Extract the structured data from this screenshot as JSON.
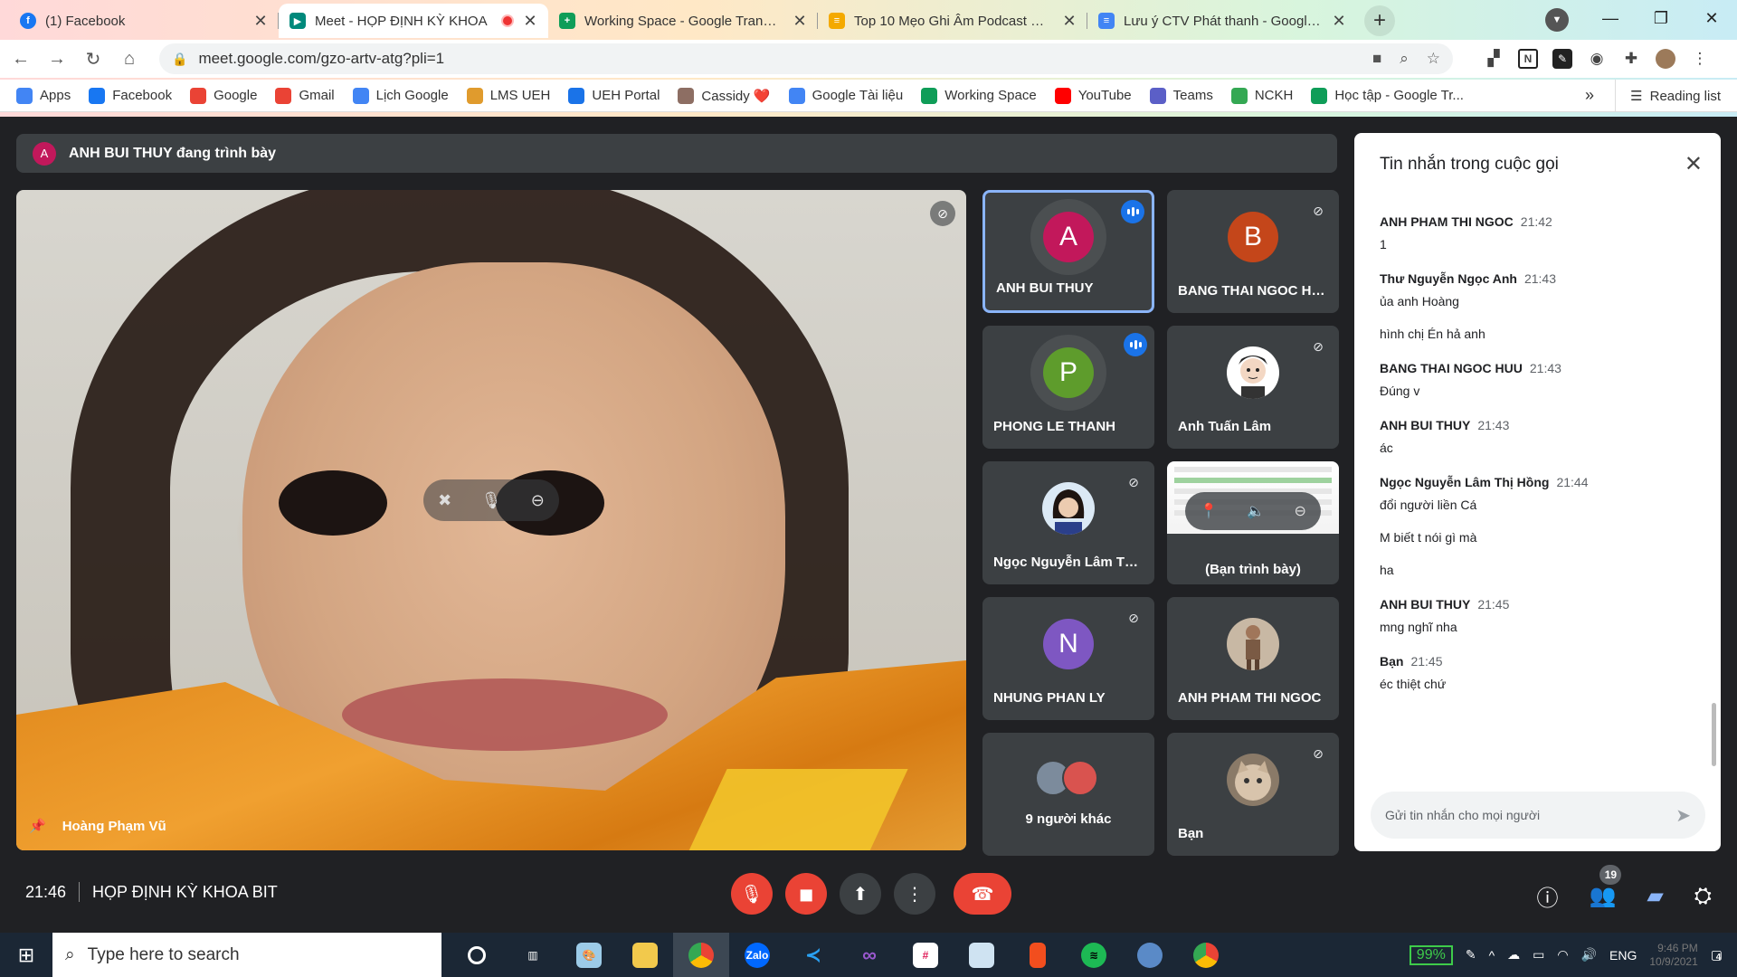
{
  "browser": {
    "tabs": [
      {
        "title": "(1) Facebook",
        "icon": "facebook-icon",
        "color": "#1877f2",
        "active": false
      },
      {
        "title": "Meet - HỌP ĐỊNH KỲ KHOA",
        "icon": "google-meet-icon",
        "color": "#00897b",
        "active": true
      },
      {
        "title": "Working Space - Google Trang tính",
        "icon": "google-sheets-icon",
        "color": "#0f9d58",
        "active": false
      },
      {
        "title": "Top 10 Mẹo Ghi Âm Podcast Chu",
        "icon": "stack-icon",
        "color": "#f4a900",
        "active": false
      },
      {
        "title": "Lưu ý CTV Phát thanh - Google T",
        "icon": "google-docs-icon",
        "color": "#4285f4",
        "active": false
      }
    ],
    "url": "meet.google.com/gzo-artv-atg?pli=1",
    "bookmarks": [
      {
        "label": "Apps",
        "icon": "apps-grid-icon",
        "color": "#4285f4"
      },
      {
        "label": "Facebook",
        "icon": "facebook-icon",
        "color": "#1877f2"
      },
      {
        "label": "Google",
        "icon": "google-icon",
        "color": "#ea4335"
      },
      {
        "label": "Gmail",
        "icon": "gmail-icon",
        "color": "#ea4335"
      },
      {
        "label": "Lịch Google",
        "icon": "calendar-icon",
        "color": "#4285f4"
      },
      {
        "label": "LMS UEH",
        "icon": "lms-icon",
        "color": "#e09b2d"
      },
      {
        "label": "UEH Portal",
        "icon": "portal-icon",
        "color": "#1a73e8"
      },
      {
        "label": "Cassidy ❤️",
        "icon": "photo-icon",
        "color": "#8d6e63"
      },
      {
        "label": "Google Tài liệu",
        "icon": "google-docs-icon",
        "color": "#4285f4"
      },
      {
        "label": "Working Space",
        "icon": "google-sheets-icon",
        "color": "#0f9d58"
      },
      {
        "label": "YouTube",
        "icon": "youtube-icon",
        "color": "#ff0000"
      },
      {
        "label": "Teams",
        "icon": "teams-icon",
        "color": "#5b5fc7"
      },
      {
        "label": "NCKH",
        "icon": "drive-icon",
        "color": "#34a853"
      },
      {
        "label": "Học tập - Google Tr...",
        "icon": "google-sheets-icon",
        "color": "#0f9d58"
      }
    ],
    "more_bookmarks": "»",
    "reading_list": "Reading list"
  },
  "meet": {
    "presenting_banner": "ANH BUI THUY đang trình bày",
    "presenting_initial": "A",
    "main_video_name": "Hoàng Phạm Vũ",
    "tiles": [
      {
        "name": "ANH BUI THUY",
        "initial": "A",
        "color": "#c2185b",
        "speaking": true
      },
      {
        "name": "BANG THAI NGOC HUU",
        "initial": "B",
        "color": "#c4461a",
        "muted": true
      },
      {
        "name": "PHONG LE THANH",
        "initial": "P",
        "color": "#5e9c2c",
        "speaking": true
      },
      {
        "name": "Anh Tuấn Lâm",
        "photo": "cartoon-avatar",
        "muted": true
      },
      {
        "name": "Ngọc Nguyễn Lâm Thị Hồng",
        "photo": "girl-avatar",
        "muted": true
      },
      {
        "name": "(Bạn trình bày)",
        "presentation": true
      },
      {
        "name": "NHUNG PHAN LY",
        "initial": "N",
        "color": "#7e57c2",
        "muted": true
      },
      {
        "name": "ANH PHAM THI NGOC",
        "photo": "person-avatar"
      },
      {
        "name": "9 người khác",
        "others": true
      },
      {
        "name": "Bạn",
        "photo": "cat-avatar",
        "muted": true
      }
    ],
    "meeting_time": "21:46",
    "meeting_title": "HỌP ĐỊNH KỲ KHOA BIT",
    "participant_count": "19"
  },
  "chat": {
    "title": "Tin nhắn trong cuộc gọi",
    "messages": [
      {
        "sender": "ANH PHAM THI NGOC",
        "time": "21:42",
        "lines": [
          "1"
        ]
      },
      {
        "sender": "Thư Nguyễn Ngọc Anh",
        "time": "21:43",
        "lines": [
          "ủa anh Hoàng",
          "hình chị Én hả anh"
        ]
      },
      {
        "sender": "BANG THAI NGOC HUU",
        "time": "21:43",
        "lines": [
          "Đúng v"
        ]
      },
      {
        "sender": "ANH BUI THUY",
        "time": "21:43",
        "lines": [
          "ác"
        ]
      },
      {
        "sender": "Ngọc Nguyễn Lâm Thị Hồng",
        "time": "21:44",
        "lines": [
          "đổi người liền Cá",
          "M biết t nói gì mà",
          "ha"
        ]
      },
      {
        "sender": "ANH BUI THUY",
        "time": "21:45",
        "lines": [
          "mng nghĩ nha"
        ]
      },
      {
        "sender": "Bạn",
        "time": "21:45",
        "lines": [
          "éc thiệt chứ"
        ]
      }
    ],
    "input_placeholder": "Gửi tin nhắn cho mọi người"
  },
  "taskbar": {
    "search_placeholder": "Type here to search",
    "battery": "99%",
    "lang": "ENG",
    "clock_time": "9:46 PM",
    "clock_date": "10/9/2021",
    "notifications": "4"
  }
}
